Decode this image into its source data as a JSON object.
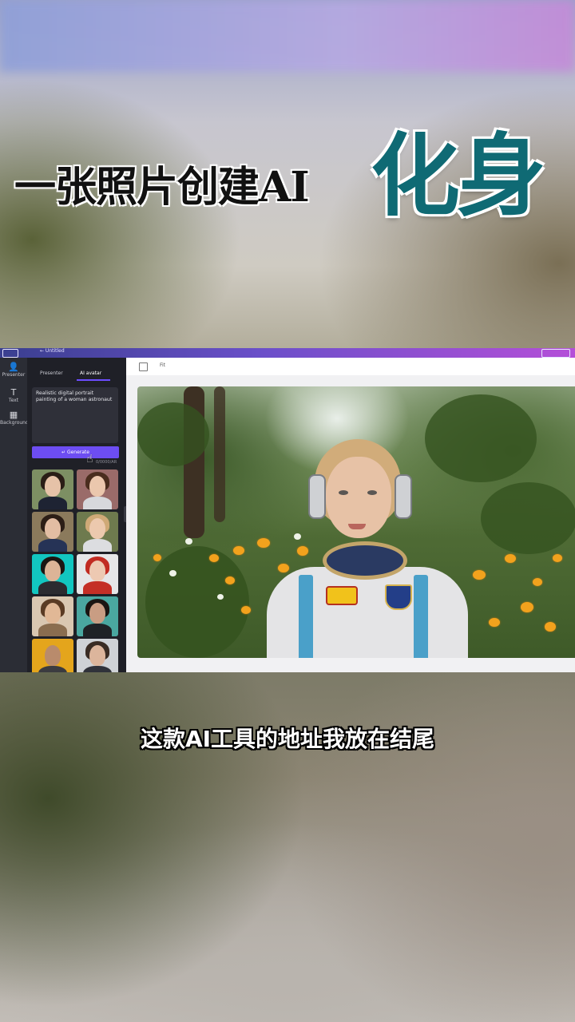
{
  "video": {
    "headline_small": "一张照片创建AI",
    "headline_big": "化身",
    "caption": "这款AI工具的地址我放在结尾"
  },
  "app": {
    "breadcrumb": "← Untitled",
    "rail": [
      {
        "icon": "person-icon",
        "label": "Presenter"
      },
      {
        "icon": "text-icon",
        "label": "Text"
      },
      {
        "icon": "background-icon",
        "label": "Background"
      }
    ],
    "tabs": [
      {
        "label": "Presenter",
        "active": false
      },
      {
        "label": "AI avatar",
        "active": true
      }
    ],
    "prompt_text": "Realistic digital portrait painting of a woman astronaut",
    "generate_label": "↵ Generate",
    "counter": "0/0000/AR",
    "toolbar": {
      "fit_label": "Fit"
    },
    "avatars": [
      {
        "name": "woman-dark-hair",
        "bg": "#7d8f63"
      },
      {
        "name": "woman-headset",
        "bg": "#9a6b69"
      },
      {
        "name": "woman-astronaut-dark",
        "bg": "#8b7a5c"
      },
      {
        "name": "woman-astronaut-blonde",
        "bg": "#6e7a4e"
      },
      {
        "name": "woman-teal-bg",
        "bg": "#12c6c0"
      },
      {
        "name": "woman-red-hair",
        "bg": "#e6e6e8"
      },
      {
        "name": "man-beige",
        "bg": "#d9c7b1"
      },
      {
        "name": "woman-dark-bg",
        "bg": "#4aa7a0"
      },
      {
        "name": "man-bald-yellow",
        "bg": "#e4a51c"
      },
      {
        "name": "man-glasses",
        "bg": "#cfd2d6"
      }
    ]
  }
}
